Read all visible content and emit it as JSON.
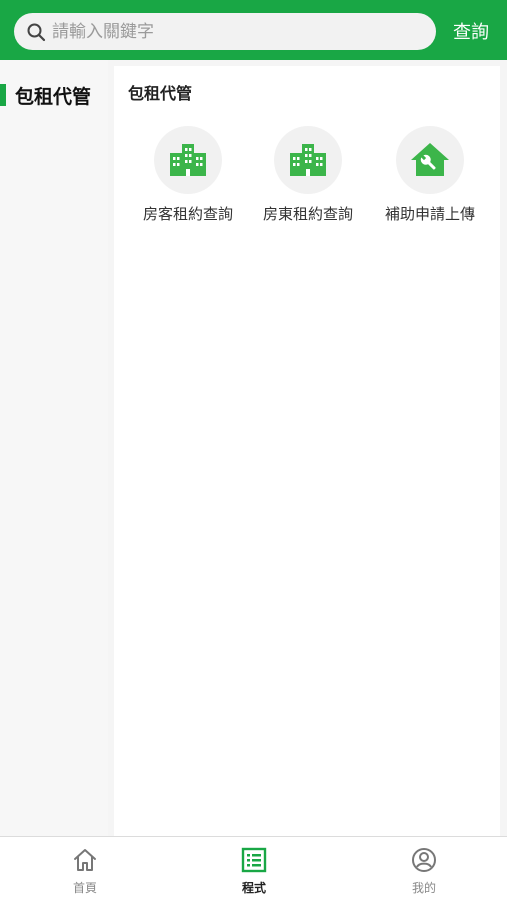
{
  "search": {
    "placeholder": "請輸入關鍵字",
    "button_label": "查詢"
  },
  "sidebar": {
    "items": [
      {
        "label": "包租代管",
        "active": true
      }
    ]
  },
  "main": {
    "section_title": "包租代管",
    "items": [
      {
        "label": "房客租約查詢",
        "icon": "building-icon"
      },
      {
        "label": "房東租約查詢",
        "icon": "building-icon"
      },
      {
        "label": "補助申請上傳",
        "icon": "house-wrench-icon"
      }
    ]
  },
  "tabbar": {
    "tabs": [
      {
        "label": "首頁",
        "icon": "home-icon",
        "active": false
      },
      {
        "label": "程式",
        "icon": "list-icon",
        "active": true
      },
      {
        "label": "我的",
        "icon": "user-icon",
        "active": false
      }
    ]
  },
  "colors": {
    "brand": "#19a745",
    "icon_green": "#3cb54a"
  }
}
